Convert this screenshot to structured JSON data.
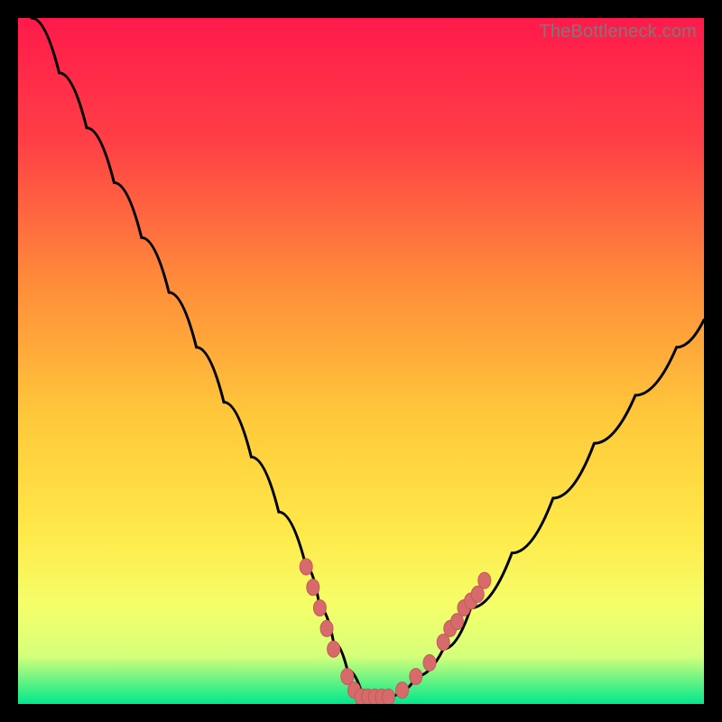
{
  "watermark": "TheBottleneck.com",
  "colors": {
    "frame": "#000000",
    "gradient_top": "#ff1a4b",
    "gradient_mid1": "#ff7a3c",
    "gradient_mid2": "#ffd83a",
    "gradient_mid3": "#f6ff66",
    "gradient_bottom": "#00e88c",
    "curve": "#000000",
    "marker_fill": "#d76a6a",
    "marker_stroke": "#c45a5a"
  },
  "chart_data": {
    "type": "line",
    "title": "",
    "xlabel": "",
    "ylabel": "",
    "xlim": [
      0,
      100
    ],
    "ylim": [
      0,
      100
    ],
    "series": [
      {
        "name": "bottleneck-curve",
        "x": [
          2,
          6,
          10,
          14,
          18,
          22,
          26,
          30,
          34,
          38,
          42,
          44,
          46,
          48,
          50,
          52,
          54,
          56,
          58,
          62,
          66,
          72,
          78,
          84,
          90,
          96,
          100
        ],
        "y": [
          100,
          92,
          84,
          76,
          68,
          60,
          52,
          44,
          36,
          28,
          20,
          14,
          9,
          5,
          2,
          1,
          1,
          2,
          4,
          8,
          14,
          22,
          30,
          38,
          45,
          52,
          56
        ]
      }
    ],
    "markers": [
      {
        "x": 42,
        "y": 20
      },
      {
        "x": 43,
        "y": 17
      },
      {
        "x": 44,
        "y": 14
      },
      {
        "x": 45,
        "y": 11
      },
      {
        "x": 46,
        "y": 8
      },
      {
        "x": 48,
        "y": 4
      },
      {
        "x": 49,
        "y": 2
      },
      {
        "x": 50,
        "y": 1
      },
      {
        "x": 51,
        "y": 1
      },
      {
        "x": 52,
        "y": 1
      },
      {
        "x": 53,
        "y": 1
      },
      {
        "x": 54,
        "y": 1
      },
      {
        "x": 56,
        "y": 2
      },
      {
        "x": 58,
        "y": 4
      },
      {
        "x": 60,
        "y": 6
      },
      {
        "x": 62,
        "y": 9
      },
      {
        "x": 63,
        "y": 11
      },
      {
        "x": 64,
        "y": 12
      },
      {
        "x": 65,
        "y": 14
      },
      {
        "x": 66,
        "y": 15
      },
      {
        "x": 67,
        "y": 16
      },
      {
        "x": 68,
        "y": 18
      }
    ]
  }
}
